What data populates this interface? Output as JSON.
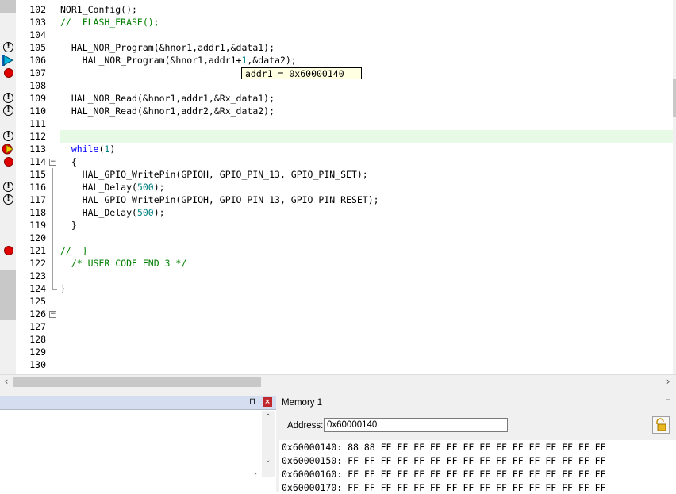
{
  "editor": {
    "lines": [
      {
        "num": "102",
        "text": "NOR1_Config();",
        "kind": "code",
        "marker": "",
        "fold": ""
      },
      {
        "num": "103",
        "text": "//  FLASH_ERASE();",
        "kind": "comment",
        "marker": "",
        "fold": ""
      },
      {
        "num": "104",
        "text": "",
        "kind": "code",
        "marker": "",
        "fold": ""
      },
      {
        "num": "105",
        "text": "  HAL_NOR_Program(&hnor1,addr1,&data1);",
        "kind": "code",
        "marker": "warning",
        "fold": ""
      },
      {
        "num": "106",
        "text": "    HAL_NOR_Program(&hnor1,addr1+1,&data2);",
        "kind": "code",
        "marker": "current",
        "fold": ""
      },
      {
        "num": "107",
        "text": "",
        "kind": "code",
        "marker": "breakpoint",
        "fold": ""
      },
      {
        "num": "108",
        "text": "",
        "kind": "code",
        "marker": "",
        "fold": ""
      },
      {
        "num": "109",
        "text": "  HAL_NOR_Read(&hnor1,addr1,&Rx_data1);",
        "kind": "code",
        "marker": "warning",
        "fold": ""
      },
      {
        "num": "110",
        "text": "  HAL_NOR_Read(&hnor1,addr2,&Rx_data2);",
        "kind": "code",
        "marker": "warning",
        "fold": ""
      },
      {
        "num": "111",
        "text": "",
        "kind": "code",
        "marker": "",
        "fold": ""
      },
      {
        "num": "112",
        "text": "",
        "kind": "code",
        "marker": "warning",
        "fold": ""
      },
      {
        "num": "113",
        "text": "  while(1)",
        "kind": "code",
        "marker": "bp-current",
        "fold": ""
      },
      {
        "num": "114",
        "text": "  {",
        "kind": "code",
        "marker": "breakpoint",
        "fold": "minus"
      },
      {
        "num": "115",
        "text": "    HAL_GPIO_WritePin(GPIOH, GPIO_PIN_13, GPIO_PIN_SET);",
        "kind": "code",
        "marker": "",
        "fold": ""
      },
      {
        "num": "116",
        "text": "    HAL_Delay(500);",
        "kind": "code",
        "marker": "warning",
        "fold": ""
      },
      {
        "num": "117",
        "text": "    HAL_GPIO_WritePin(GPIOH, GPIO_PIN_13, GPIO_PIN_RESET);",
        "kind": "code",
        "marker": "warning",
        "fold": ""
      },
      {
        "num": "118",
        "text": "    HAL_Delay(500);",
        "kind": "code",
        "marker": "",
        "fold": ""
      },
      {
        "num": "119",
        "text": "  }",
        "kind": "code",
        "marker": "",
        "fold": ""
      },
      {
        "num": "120",
        "text": "",
        "kind": "code",
        "marker": "",
        "fold": "end"
      },
      {
        "num": "121",
        "text": "//  }",
        "kind": "comment",
        "marker": "breakpoint",
        "fold": ""
      },
      {
        "num": "122",
        "text": "  /* USER CODE END 3 */",
        "kind": "comment",
        "marker": "",
        "fold": ""
      },
      {
        "num": "123",
        "text": "",
        "kind": "code",
        "marker": "",
        "fold": ""
      },
      {
        "num": "124",
        "text": "}",
        "kind": "code",
        "marker": "",
        "fold": "end"
      },
      {
        "num": "125",
        "text": "",
        "kind": "code",
        "marker": "",
        "fold": ""
      },
      {
        "num": "126",
        "text": "",
        "kind": "code",
        "marker": "",
        "fold": "minus"
      },
      {
        "num": "127",
        "text": "",
        "kind": "code",
        "marker": "",
        "fold": ""
      },
      {
        "num": "128",
        "text": "",
        "kind": "code",
        "marker": "",
        "fold": ""
      },
      {
        "num": "129",
        "text": "",
        "kind": "code",
        "marker": "",
        "fold": ""
      },
      {
        "num": "130",
        "text": "",
        "kind": "code",
        "marker": "",
        "fold": ""
      }
    ],
    "tooltip": "addr1 = 0x60000140"
  },
  "memory": {
    "title": "Memory 1",
    "address_label": "Address:",
    "address_value": "0x60000140",
    "rows": [
      {
        "addr": "0x60000140:",
        "bytes": "88 88 FF FF FF FF FF FF FF FF FF FF FF FF FF FF"
      },
      {
        "addr": "0x60000150:",
        "bytes": "FF FF FF FF FF FF FF FF FF FF FF FF FF FF FF FF"
      },
      {
        "addr": "0x60000160:",
        "bytes": "FF FF FF FF FF FF FF FF FF FF FF FF FF FF FF FF"
      },
      {
        "addr": "0x60000170:",
        "bytes": "FF FF FF FF FF FF FF FF FF FF FF FF FF FF FF FF"
      }
    ]
  },
  "icons": {
    "pin": "pin-icon",
    "close": "close-icon",
    "lock": "lock-icon"
  },
  "colors": {
    "breakpoint": "#e00000",
    "current_arrow": "#00b4dc",
    "exec_arrow": "#f2d000",
    "comment": "#008000",
    "keyword": "#0000ff",
    "number": "#008080",
    "current_line": "#e6fae6",
    "tooltip_bg": "#ffffe1",
    "panel_header": "#d5def0",
    "close_red": "#c0282d"
  }
}
